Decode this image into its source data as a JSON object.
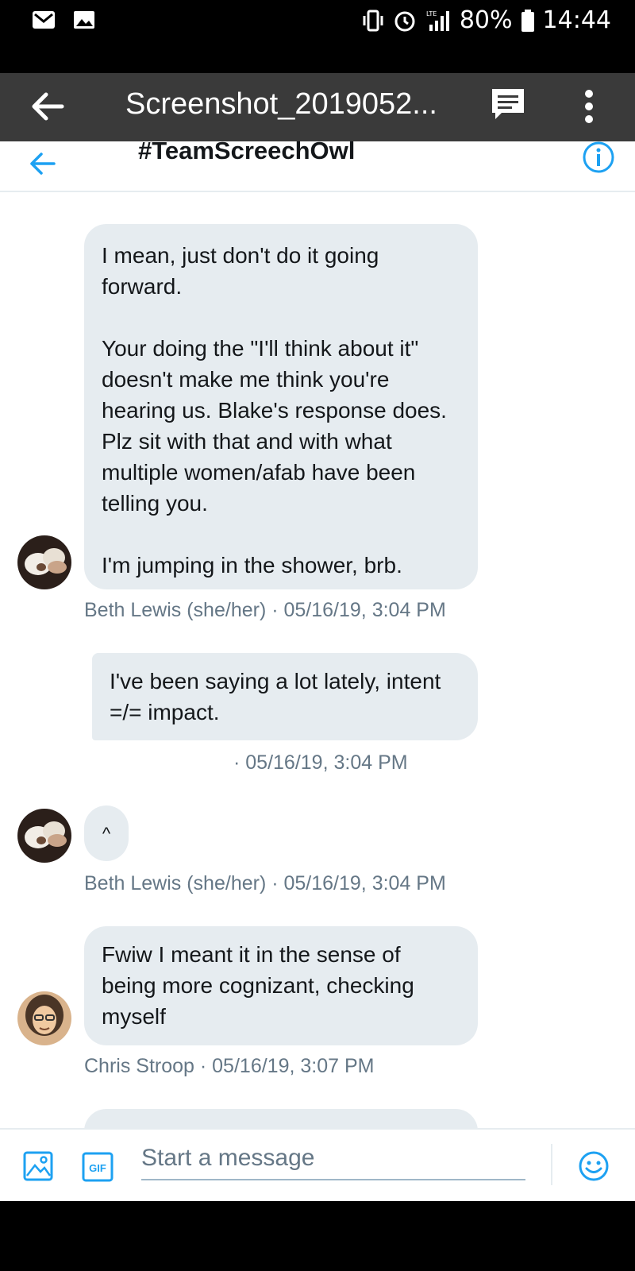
{
  "status_bar": {
    "battery": "80%",
    "time": "14:44",
    "network": "LTE"
  },
  "viewer": {
    "title": "Screenshot_2019052..."
  },
  "dm": {
    "title": "#TeamScreechOwl"
  },
  "messages": [
    {
      "text": "I mean, just don't do it going forward.\n\nYour doing the \"I'll think about it\" doesn't make me think you're hearing us. Blake's response does. Plz sit with that and with what multiple women/afab have been telling you.\n\nI'm jumping in the shower, brb.",
      "meta": "Beth Lewis (she/her) · 05/16/19, 3:04 PM"
    },
    {
      "text": "I've been saying a lot lately, intent =/= impact.",
      "meta": "· 05/16/19, 3:04 PM"
    },
    {
      "text": "^",
      "meta": "Beth Lewis (she/her) · 05/16/19, 3:04 PM"
    },
    {
      "text": "Fwiw I meant it in the sense of being more cognizant, checking myself",
      "meta": "Chris Stroop · 05/16/19, 3:07 PM"
    }
  ],
  "composer": {
    "placeholder": "Start a message",
    "gif_label": "GIF"
  },
  "colors": {
    "accent": "#1da1f2",
    "bubble": "#e6ecf0",
    "meta_text": "#657786"
  }
}
